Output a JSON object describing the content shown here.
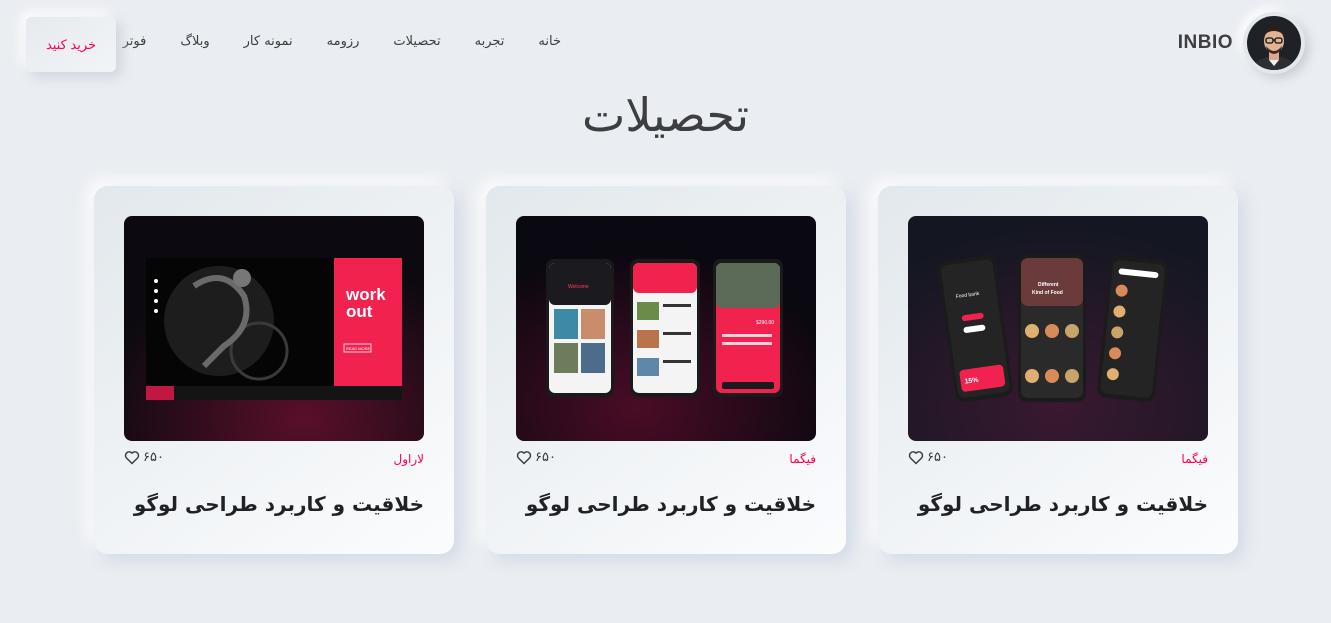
{
  "brand": {
    "name": "INBIO"
  },
  "nav": {
    "items": [
      "خانه",
      "تجربه",
      "تحصیلات",
      "رزومه",
      "نمونه کار",
      "وبلاگ",
      "فوتر"
    ]
  },
  "buy_button": {
    "label": "خرید کنید"
  },
  "section": {
    "title": "تحصیلات"
  },
  "colors": {
    "accent": "#ff014f",
    "background": "#eaedf1",
    "text": "#3c3e41"
  },
  "cards": [
    {
      "category": "فیگما",
      "likes": "۶۵۰",
      "title": "خلاقیت و کاربرد طراحی لوگو",
      "image": "food-app-mockup",
      "image_text": {
        "food_bank": "Food bank",
        "different": "Different",
        "kind": "Kind of Food",
        "discount": "15%"
      }
    },
    {
      "category": "فیگما",
      "likes": "۶۵۰",
      "title": "خلاقیت و کاربرد طراحی لوگو",
      "image": "travel-app-mockup",
      "image_text": {
        "welcome": "Welcome",
        "price": "$290.00"
      }
    },
    {
      "category": "لاراول",
      "likes": "۶۵۰",
      "title": "خلاقیت و کاربرد طراحی لوگو",
      "image": "workout-landing-mockup",
      "image_text": {
        "work": "work",
        "out": "out",
        "button": "READ MORE"
      }
    }
  ]
}
